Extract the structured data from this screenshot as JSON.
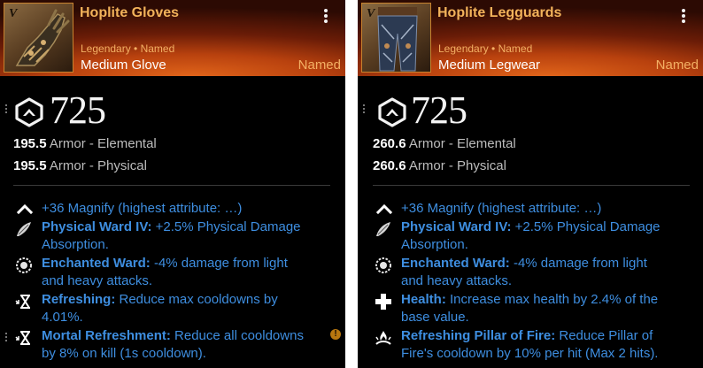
{
  "cards": [
    {
      "tier": "V",
      "name": "Hoplite Gloves",
      "rarity": "Legendary • Named",
      "type": "Medium Glove",
      "named_tag": "Named",
      "gear_score": "725",
      "armor": [
        {
          "value": "195.5",
          "label": "Armor - Elemental"
        },
        {
          "value": "195.5",
          "label": "Armor - Physical"
        }
      ],
      "attribute": "+36 Magnify (highest attribute: …)",
      "perks": [
        {
          "icon": "ward-feather-icon",
          "name": "Physical Ward IV:",
          "line1": " +2.5% Physical Damage",
          "line2": "Absorption."
        },
        {
          "icon": "enchanted-ward-icon",
          "name": "Enchanted Ward:",
          "line1": " -4% damage from light",
          "line2": "and heavy attacks."
        },
        {
          "icon": "hourglass-icon",
          "name": "Refreshing:",
          "line1": " Reduce max cooldowns by",
          "line2": "4.01%."
        },
        {
          "icon": "hourglass-icon",
          "name": "Mortal Refreshment:",
          "line1": " Reduce all cooldowns",
          "line2": "by 8% on kill (1s cooldown)."
        }
      ],
      "info_badge": "!"
    },
    {
      "tier": "V",
      "name": "Hoplite Legguards",
      "rarity": "Legendary • Named",
      "type": "Medium Legwear",
      "named_tag": "Named",
      "gear_score": "725",
      "armor": [
        {
          "value": "260.6",
          "label": "Armor - Elemental"
        },
        {
          "value": "260.6",
          "label": "Armor - Physical"
        }
      ],
      "attribute": "+36 Magnify (highest attribute: …)",
      "perks": [
        {
          "icon": "ward-feather-icon",
          "name": "Physical Ward IV:",
          "line1": " +2.5% Physical Damage",
          "line2": "Absorption."
        },
        {
          "icon": "enchanted-ward-icon",
          "name": "Enchanted Ward:",
          "line1": " -4% damage from light",
          "line2": "and heavy attacks."
        },
        {
          "icon": "health-cross-icon",
          "name": "Health:",
          "line1": " Increase max health by 2.4% of the",
          "line2": "base value."
        },
        {
          "icon": "pillar-of-fire-icon",
          "name": "Refreshing Pillar of Fire:",
          "line1": " Reduce Pillar of",
          "line2": "Fire's cooldown by 10% per hit (Max 2 hits)."
        }
      ]
    }
  ],
  "colors": {
    "item_name": "#f2b25a",
    "rarity": "#f3b064",
    "perk_text": "#3e8ee0",
    "background": "#000000"
  }
}
